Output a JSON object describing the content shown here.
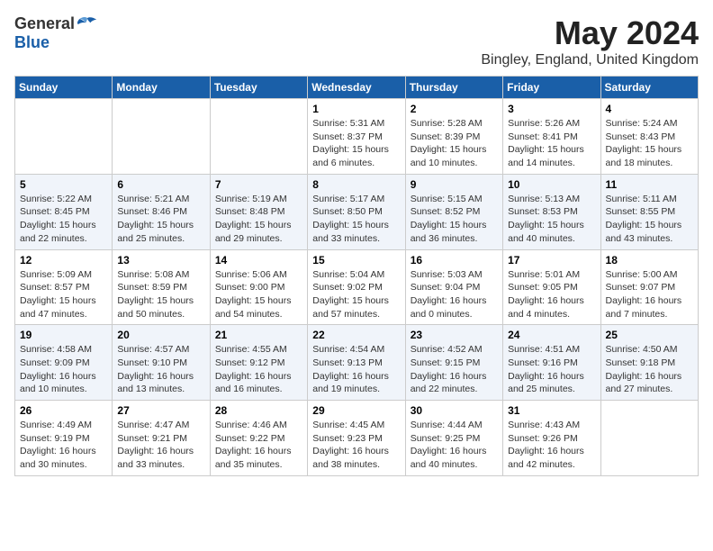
{
  "logo": {
    "general": "General",
    "blue": "Blue"
  },
  "title": {
    "month": "May 2024",
    "location": "Bingley, England, United Kingdom"
  },
  "weekdays": [
    "Sunday",
    "Monday",
    "Tuesday",
    "Wednesday",
    "Thursday",
    "Friday",
    "Saturday"
  ],
  "weeks": [
    [
      {
        "day": "",
        "info": ""
      },
      {
        "day": "",
        "info": ""
      },
      {
        "day": "",
        "info": ""
      },
      {
        "day": "1",
        "info": "Sunrise: 5:31 AM\nSunset: 8:37 PM\nDaylight: 15 hours\nand 6 minutes."
      },
      {
        "day": "2",
        "info": "Sunrise: 5:28 AM\nSunset: 8:39 PM\nDaylight: 15 hours\nand 10 minutes."
      },
      {
        "day": "3",
        "info": "Sunrise: 5:26 AM\nSunset: 8:41 PM\nDaylight: 15 hours\nand 14 minutes."
      },
      {
        "day": "4",
        "info": "Sunrise: 5:24 AM\nSunset: 8:43 PM\nDaylight: 15 hours\nand 18 minutes."
      }
    ],
    [
      {
        "day": "5",
        "info": "Sunrise: 5:22 AM\nSunset: 8:45 PM\nDaylight: 15 hours\nand 22 minutes."
      },
      {
        "day": "6",
        "info": "Sunrise: 5:21 AM\nSunset: 8:46 PM\nDaylight: 15 hours\nand 25 minutes."
      },
      {
        "day": "7",
        "info": "Sunrise: 5:19 AM\nSunset: 8:48 PM\nDaylight: 15 hours\nand 29 minutes."
      },
      {
        "day": "8",
        "info": "Sunrise: 5:17 AM\nSunset: 8:50 PM\nDaylight: 15 hours\nand 33 minutes."
      },
      {
        "day": "9",
        "info": "Sunrise: 5:15 AM\nSunset: 8:52 PM\nDaylight: 15 hours\nand 36 minutes."
      },
      {
        "day": "10",
        "info": "Sunrise: 5:13 AM\nSunset: 8:53 PM\nDaylight: 15 hours\nand 40 minutes."
      },
      {
        "day": "11",
        "info": "Sunrise: 5:11 AM\nSunset: 8:55 PM\nDaylight: 15 hours\nand 43 minutes."
      }
    ],
    [
      {
        "day": "12",
        "info": "Sunrise: 5:09 AM\nSunset: 8:57 PM\nDaylight: 15 hours\nand 47 minutes."
      },
      {
        "day": "13",
        "info": "Sunrise: 5:08 AM\nSunset: 8:59 PM\nDaylight: 15 hours\nand 50 minutes."
      },
      {
        "day": "14",
        "info": "Sunrise: 5:06 AM\nSunset: 9:00 PM\nDaylight: 15 hours\nand 54 minutes."
      },
      {
        "day": "15",
        "info": "Sunrise: 5:04 AM\nSunset: 9:02 PM\nDaylight: 15 hours\nand 57 minutes."
      },
      {
        "day": "16",
        "info": "Sunrise: 5:03 AM\nSunset: 9:04 PM\nDaylight: 16 hours\nand 0 minutes."
      },
      {
        "day": "17",
        "info": "Sunrise: 5:01 AM\nSunset: 9:05 PM\nDaylight: 16 hours\nand 4 minutes."
      },
      {
        "day": "18",
        "info": "Sunrise: 5:00 AM\nSunset: 9:07 PM\nDaylight: 16 hours\nand 7 minutes."
      }
    ],
    [
      {
        "day": "19",
        "info": "Sunrise: 4:58 AM\nSunset: 9:09 PM\nDaylight: 16 hours\nand 10 minutes."
      },
      {
        "day": "20",
        "info": "Sunrise: 4:57 AM\nSunset: 9:10 PM\nDaylight: 16 hours\nand 13 minutes."
      },
      {
        "day": "21",
        "info": "Sunrise: 4:55 AM\nSunset: 9:12 PM\nDaylight: 16 hours\nand 16 minutes."
      },
      {
        "day": "22",
        "info": "Sunrise: 4:54 AM\nSunset: 9:13 PM\nDaylight: 16 hours\nand 19 minutes."
      },
      {
        "day": "23",
        "info": "Sunrise: 4:52 AM\nSunset: 9:15 PM\nDaylight: 16 hours\nand 22 minutes."
      },
      {
        "day": "24",
        "info": "Sunrise: 4:51 AM\nSunset: 9:16 PM\nDaylight: 16 hours\nand 25 minutes."
      },
      {
        "day": "25",
        "info": "Sunrise: 4:50 AM\nSunset: 9:18 PM\nDaylight: 16 hours\nand 27 minutes."
      }
    ],
    [
      {
        "day": "26",
        "info": "Sunrise: 4:49 AM\nSunset: 9:19 PM\nDaylight: 16 hours\nand 30 minutes."
      },
      {
        "day": "27",
        "info": "Sunrise: 4:47 AM\nSunset: 9:21 PM\nDaylight: 16 hours\nand 33 minutes."
      },
      {
        "day": "28",
        "info": "Sunrise: 4:46 AM\nSunset: 9:22 PM\nDaylight: 16 hours\nand 35 minutes."
      },
      {
        "day": "29",
        "info": "Sunrise: 4:45 AM\nSunset: 9:23 PM\nDaylight: 16 hours\nand 38 minutes."
      },
      {
        "day": "30",
        "info": "Sunrise: 4:44 AM\nSunset: 9:25 PM\nDaylight: 16 hours\nand 40 minutes."
      },
      {
        "day": "31",
        "info": "Sunrise: 4:43 AM\nSunset: 9:26 PM\nDaylight: 16 hours\nand 42 minutes."
      },
      {
        "day": "",
        "info": ""
      }
    ]
  ]
}
